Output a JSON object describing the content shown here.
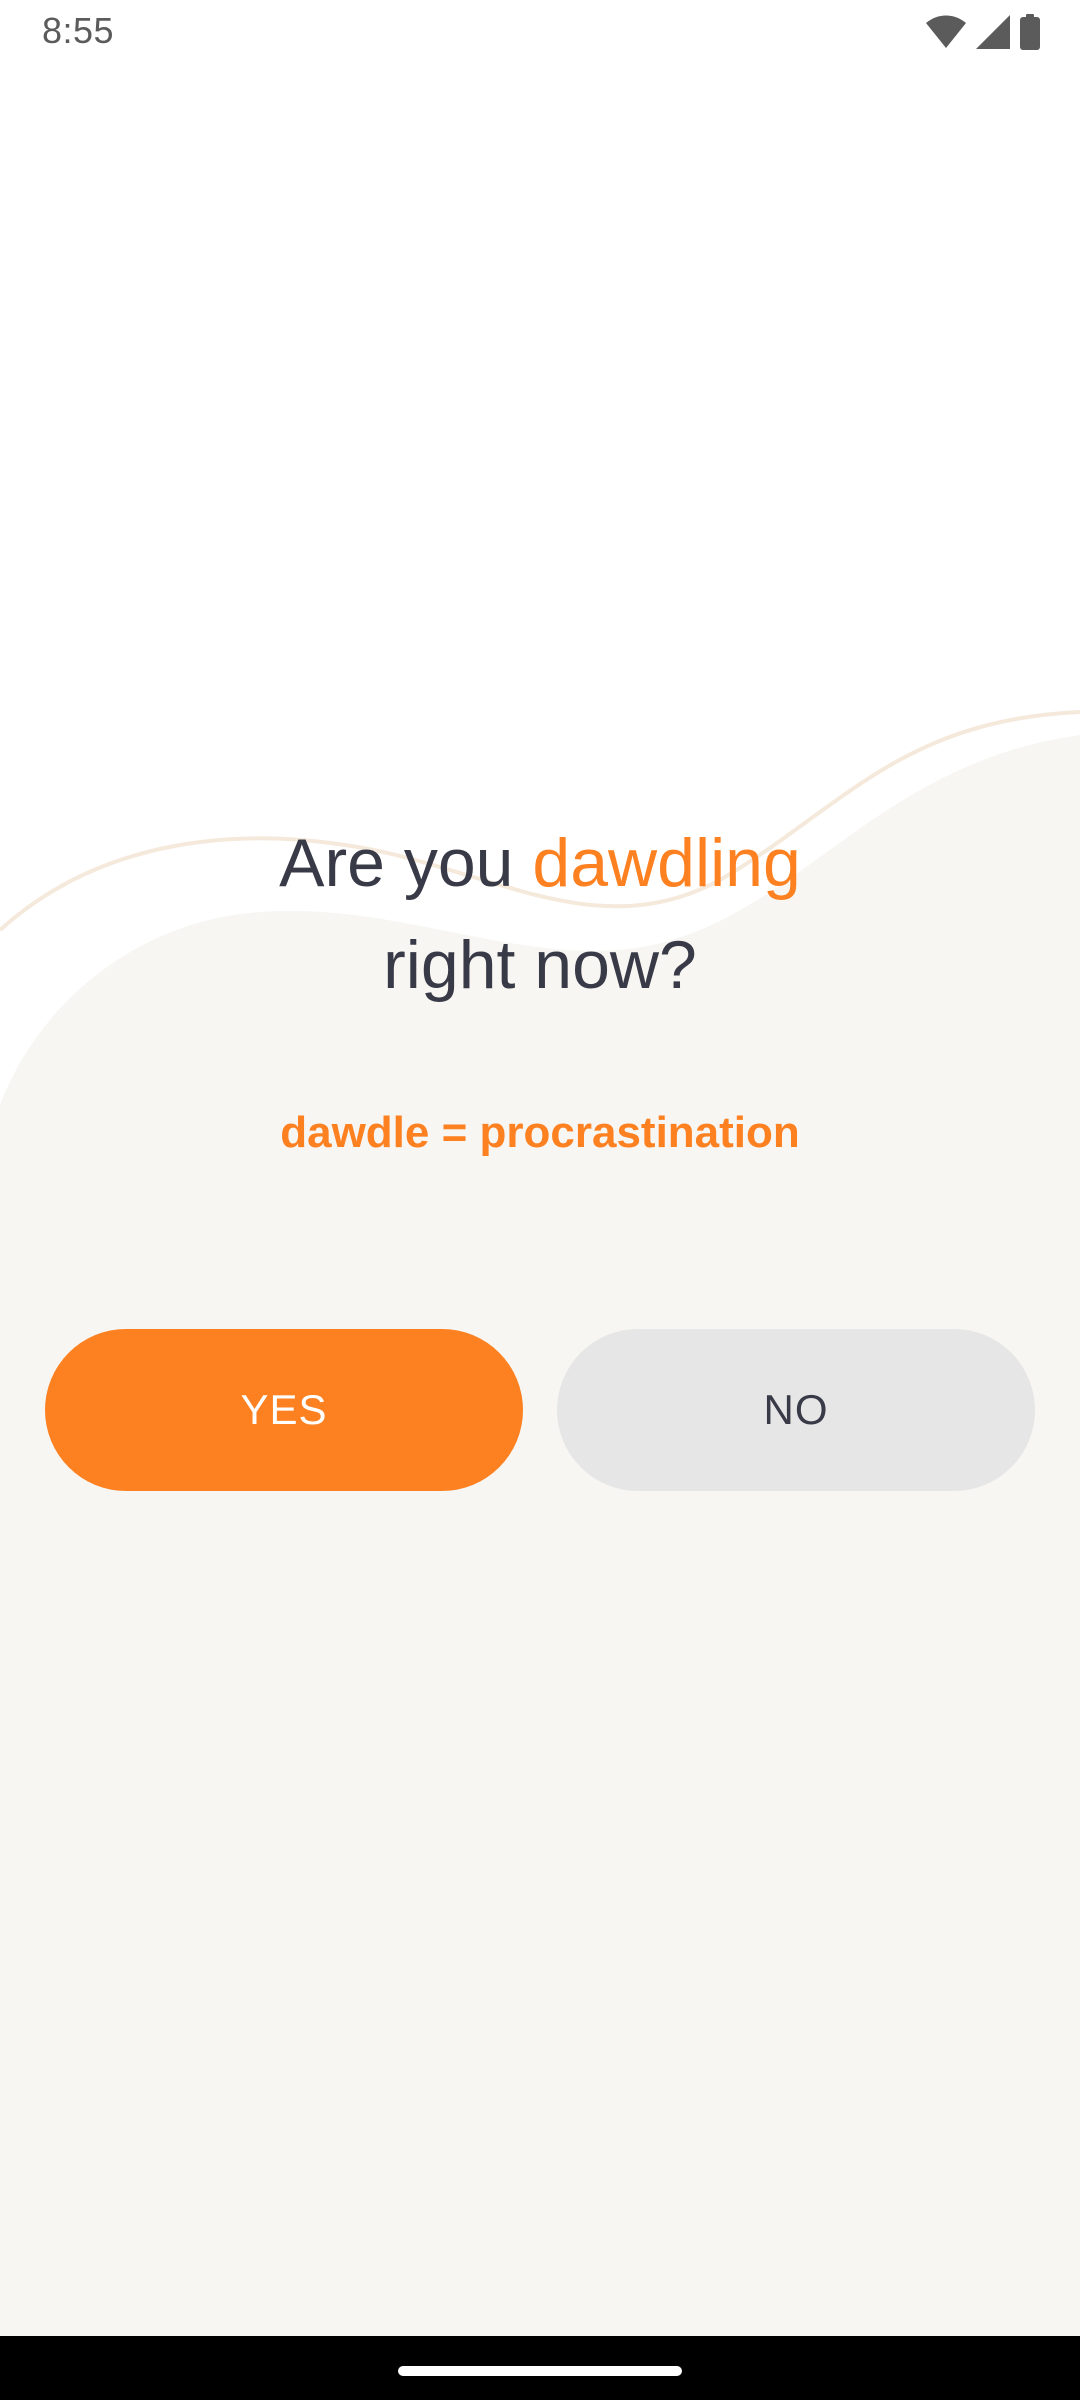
{
  "status_bar": {
    "time": "8:55",
    "icons": [
      "wifi-icon",
      "cellular-signal-icon",
      "battery-icon"
    ]
  },
  "prompt": {
    "line1_prefix": "Are you ",
    "line1_accent": "dawdling",
    "line2": "right now?",
    "definition": "dawdle = procrastination"
  },
  "buttons": {
    "yes_label": "YES",
    "no_label": "NO"
  },
  "colors": {
    "accent": "#fd8021",
    "text_dark": "#393a47",
    "background_warm": "#f7f6f3",
    "button_secondary": "#e6e6e6"
  }
}
